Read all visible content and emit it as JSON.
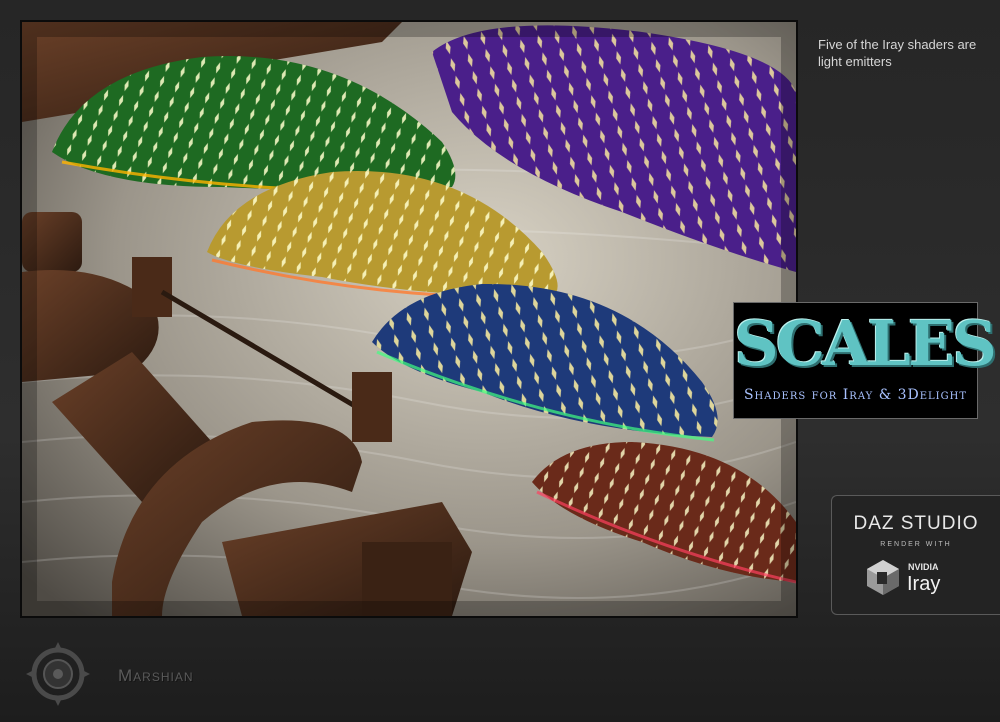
{
  "render": {
    "alt": "Glowing scale-covered mounds in rainbow colors resting on rippled sand beside rusty metal debris"
  },
  "caption": {
    "text": "Five of the Iray shaders are light emitters"
  },
  "logo": {
    "title": "SCALES",
    "subtitle": "Shaders for Iray & 3Delight"
  },
  "badge": {
    "title": "DAZ STUDIO",
    "subtitle": "RENDER WITH",
    "brand": "NVIDIA",
    "product": "Iray"
  },
  "footer": {
    "brand": "Marshian"
  },
  "colors": {
    "background": "#2a2a2a",
    "logo_accent": "#5fc3c3",
    "logo_subtitle": "#a9c2ff",
    "mound_green": "#1e6a22",
    "mound_gold": "#b89a30",
    "mound_blue": "#1e3a7a",
    "mound_purple": "#4a1f8a",
    "mound_red": "#6a2a1a"
  }
}
